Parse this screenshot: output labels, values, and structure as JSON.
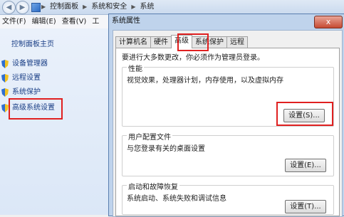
{
  "breadcrumb": {
    "items": [
      "控制面板",
      "系统和安全",
      "系统"
    ]
  },
  "menubar": {
    "items": [
      "文件(F)",
      "编辑(E)",
      "查看(V)",
      "工"
    ]
  },
  "leftpane": {
    "home": "控制面板主页",
    "items": [
      "设备管理器",
      "远程设置",
      "系统保护",
      "高级系统设置"
    ]
  },
  "dialog": {
    "title": "系统属性",
    "close_label": "x",
    "tabs": [
      "计算机名",
      "硬件",
      "高级",
      "系统保护",
      "远程"
    ],
    "active_tab": "高级",
    "admin_note": "要进行大多数更改，你必须作为管理员登录。",
    "groups": [
      {
        "title": "性能",
        "desc": "视觉效果，处理器计划，内存使用，以及虚拟内存",
        "button": "设置(S)..."
      },
      {
        "title": "用户配置文件",
        "desc": "与您登录有关的桌面设置",
        "button": "设置(E)..."
      },
      {
        "title": "启动和故障恢复",
        "desc": "系统启动、系统失败和调试信息",
        "button": "设置(T)..."
      }
    ]
  },
  "colors": {
    "highlight": "#e02020"
  }
}
